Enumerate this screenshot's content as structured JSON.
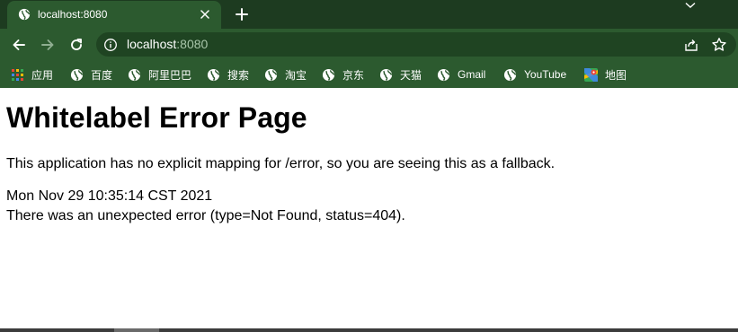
{
  "tab": {
    "title": "localhost:8080"
  },
  "omnibox": {
    "host": "localhost",
    "port": ":8080"
  },
  "bookmarks": [
    {
      "label": "应用",
      "icon": "apps-grid-icon"
    },
    {
      "label": "百度",
      "icon": "globe-icon"
    },
    {
      "label": "阿里巴巴",
      "icon": "globe-icon"
    },
    {
      "label": "搜索",
      "icon": "globe-icon"
    },
    {
      "label": "淘宝",
      "icon": "globe-icon"
    },
    {
      "label": "京东",
      "icon": "globe-icon"
    },
    {
      "label": "天猫",
      "icon": "globe-icon"
    },
    {
      "label": "Gmail",
      "icon": "globe-icon"
    },
    {
      "label": "YouTube",
      "icon": "globe-icon"
    },
    {
      "label": "地图",
      "icon": "maps-icon"
    }
  ],
  "page": {
    "title": "Whitelabel Error Page",
    "message": "This application has no explicit mapping for /error, so you are seeing this as a fallback.",
    "timestamp": "Mon Nov 29 10:35:14 CST 2021",
    "error": "There was an unexpected error (type=Not Found, status=404)."
  },
  "colors": {
    "frame": "#1d3b20",
    "toolbar": "#2c5a2f",
    "omnibox": "#1f4422"
  }
}
